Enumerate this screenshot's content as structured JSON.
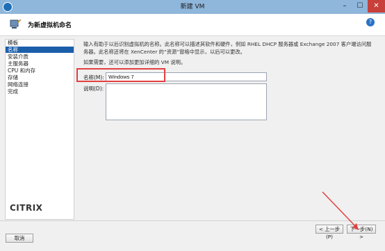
{
  "window": {
    "title": "新建 VM",
    "minimize": "–",
    "maximize": "☐",
    "close": "✕"
  },
  "header": {
    "title": "为新虚拟机命名",
    "help_icon": "?"
  },
  "sidebar": {
    "items": [
      {
        "label": "模板",
        "active": false
      },
      {
        "label": "名称",
        "active": true
      },
      {
        "label": "安装介质",
        "active": false
      },
      {
        "label": "主服务器",
        "active": false
      },
      {
        "label": "CPU 和内存",
        "active": false
      },
      {
        "label": "存储",
        "active": false
      },
      {
        "label": "网络连接",
        "active": false
      },
      {
        "label": "完成",
        "active": false
      }
    ],
    "logo": "CITRIX"
  },
  "main": {
    "intro": "输入有助于以后识别虚拟机的名称。此名称可以描述其软件和硬件，例如 RHEL DHCP 服务器或 Exchange 2007 客户端访问服务器。此名称还将在 XenCenter 的“资源”窗格中显示，以后可以更改。",
    "hint": "如果需要，还可以添加更加详细的 VM 说明。",
    "name_label": "名称(M):",
    "name_value": "Windows 7",
    "desc_label": "说明(D):",
    "desc_value": ""
  },
  "footer": {
    "prev": "< 上一步(P)",
    "next": "下一步(N) >",
    "cancel": "取消"
  },
  "colors": {
    "accent": "#1b5eaa",
    "annotation": "#e43f3f",
    "titlebar": "#8fb6db"
  }
}
